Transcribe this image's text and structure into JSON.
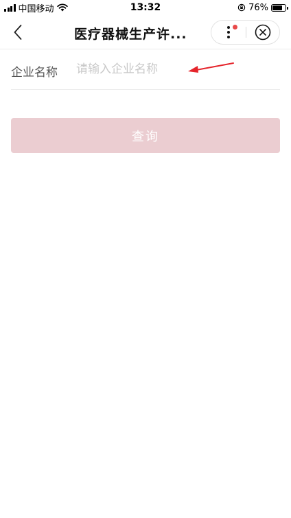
{
  "status_bar": {
    "carrier": "中国移动",
    "time": "13:32",
    "battery_percent": 76,
    "battery_text": "76%"
  },
  "nav": {
    "title": "医疗器械生产许...",
    "icons": {
      "back": "chevron-left-icon",
      "more": "more-vertical-icon",
      "close": "close-circle-icon"
    },
    "badge_color": "#e84a4a"
  },
  "form": {
    "company_name_label": "企业名称",
    "company_name_value": "",
    "company_name_placeholder": "请输入企业名称"
  },
  "actions": {
    "search_label": "查询"
  },
  "colors": {
    "primary_disabled": "#ebcdd1",
    "annotation_arrow": "#e5242b"
  }
}
